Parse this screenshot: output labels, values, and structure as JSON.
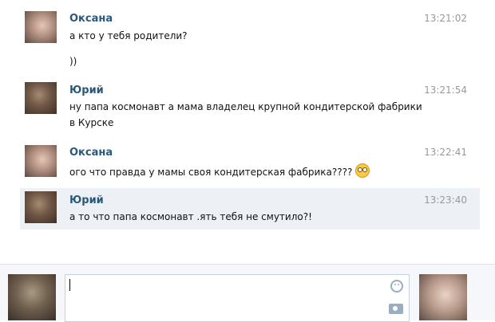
{
  "messages": [
    {
      "name": "Оксана",
      "time": "13:21:02",
      "lines": [
        "а кто у тебя родители?",
        "))"
      ]
    },
    {
      "name": "Юрий",
      "time": "13:21:54",
      "lines": [
        "ну папа космонавт а мама владелец крупной кондитерской фабрики",
        "в Курске"
      ]
    },
    {
      "name": "Оксана",
      "time": "13:22:41",
      "lines": [
        "ого что правда у мамы своя кондитерская фабрика????"
      ],
      "emoji": "flushed-face-emoji"
    },
    {
      "name": "Юрий",
      "time": "13:23:40",
      "lines": [
        "а то что папа космонавт .ять тебя не смутило?!"
      ],
      "highlighted": true
    }
  ],
  "composer": {
    "input_value": "",
    "icons": [
      "smile-icon",
      "camera-icon"
    ]
  },
  "colors": {
    "name": "#2b587a",
    "time": "#999999",
    "highlight_bg": "#edf1f5",
    "composer_bg": "#f5f7fa"
  }
}
